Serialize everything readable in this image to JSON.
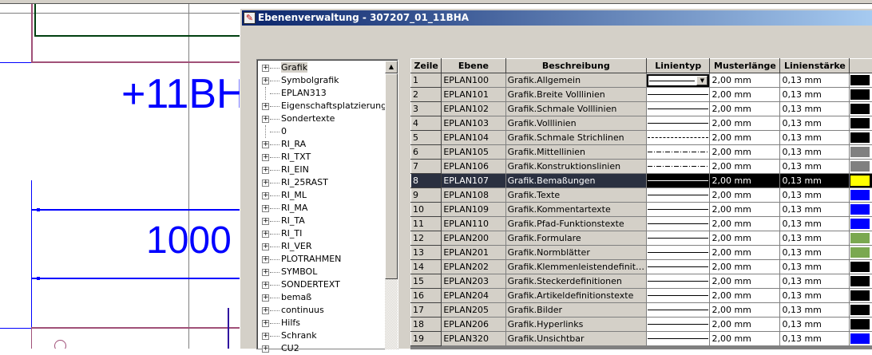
{
  "canvas": {
    "label_top": "+11BH",
    "dimension": "1000"
  },
  "dialog": {
    "title": "Ebenenverwaltung - 307207_01_11BHA"
  },
  "tree": {
    "items": [
      {
        "label": "Grafik",
        "expandable": true
      },
      {
        "label": "Symbolgrafik",
        "expandable": true
      },
      {
        "label": "EPLAN313",
        "expandable": false
      },
      {
        "label": "Eigenschaftsplatzierung",
        "expandable": true
      },
      {
        "label": "Sondertexte",
        "expandable": true
      },
      {
        "label": "0",
        "expandable": false
      },
      {
        "label": "RI_RA",
        "expandable": true
      },
      {
        "label": "RI_TXT",
        "expandable": true
      },
      {
        "label": "RI_EIN",
        "expandable": true
      },
      {
        "label": "RI_25RAST",
        "expandable": true
      },
      {
        "label": "RI_ML",
        "expandable": true
      },
      {
        "label": "RI_MA",
        "expandable": true
      },
      {
        "label": "RI_TA",
        "expandable": true
      },
      {
        "label": "RI_TI",
        "expandable": true
      },
      {
        "label": "RI_VER",
        "expandable": true
      },
      {
        "label": "PLOTRAHMEN",
        "expandable": true
      },
      {
        "label": "SYMBOL",
        "expandable": true
      },
      {
        "label": "SONDERTEXT",
        "expandable": true
      },
      {
        "label": "bemaß",
        "expandable": true
      },
      {
        "label": "continuus",
        "expandable": true
      },
      {
        "label": "Hilfs",
        "expandable": true
      },
      {
        "label": "Schrank",
        "expandable": true
      },
      {
        "label": "CU2",
        "expandable": true
      }
    ]
  },
  "table": {
    "headers": [
      "Zeile",
      "Ebene",
      "Beschreibung",
      "Linientyp",
      "Musterlänge",
      "Linienstärke",
      ""
    ],
    "rows": [
      {
        "zeile": "1",
        "ebene": "EPLAN100",
        "beschreibung": "Grafik.Allgemein",
        "linetype": "solid",
        "muster": "2,00 mm",
        "staerke": "0,13 mm",
        "color": "#000000"
      },
      {
        "zeile": "2",
        "ebene": "EPLAN101",
        "beschreibung": "Grafik.Breite Volllinien",
        "linetype": "solid",
        "muster": "2,00 mm",
        "staerke": "0,13 mm",
        "color": "#000000"
      },
      {
        "zeile": "3",
        "ebene": "EPLAN102",
        "beschreibung": "Grafik.Schmale Volllinien",
        "linetype": "solid",
        "muster": "2,00 mm",
        "staerke": "0,13 mm",
        "color": "#000000"
      },
      {
        "zeile": "4",
        "ebene": "EPLAN103",
        "beschreibung": "Grafik.Volllinien",
        "linetype": "solid",
        "muster": "2,00 mm",
        "staerke": "0,13 mm",
        "color": "#000000"
      },
      {
        "zeile": "5",
        "ebene": "EPLAN104",
        "beschreibung": "Grafik.Schmale Strichlinen",
        "linetype": "dashed",
        "muster": "2,00 mm",
        "staerke": "0,13 mm",
        "color": "#000000"
      },
      {
        "zeile": "6",
        "ebene": "EPLAN105",
        "beschreibung": "Grafik.Mittellinien",
        "linetype": "dashdot",
        "muster": "2,00 mm",
        "staerke": "0,13 mm",
        "color": "#808080"
      },
      {
        "zeile": "7",
        "ebene": "EPLAN106",
        "beschreibung": "Grafik.Konstruktionslinien",
        "linetype": "dashdot",
        "muster": "2,00 mm",
        "staerke": "0,13 mm",
        "color": "#808080"
      },
      {
        "zeile": "8",
        "ebene": "EPLAN107",
        "beschreibung": "Grafik.Bemaßungen",
        "linetype": "solid",
        "muster": "2,00 mm",
        "staerke": "0,13 mm",
        "color": "#ffff00",
        "selected": true
      },
      {
        "zeile": "9",
        "ebene": "EPLAN108",
        "beschreibung": "Grafik.Texte",
        "linetype": "solid",
        "muster": "2,00 mm",
        "staerke": "0,13 mm",
        "color": "#0000ff"
      },
      {
        "zeile": "10",
        "ebene": "EPLAN109",
        "beschreibung": "Grafik.Kommentartexte",
        "linetype": "solid",
        "muster": "2,00 mm",
        "staerke": "0,13 mm",
        "color": "#0000ff"
      },
      {
        "zeile": "11",
        "ebene": "EPLAN110",
        "beschreibung": "Grafik.Pfad-Funktionstexte",
        "linetype": "solid",
        "muster": "2,00 mm",
        "staerke": "0,13 mm",
        "color": "#0000ff"
      },
      {
        "zeile": "12",
        "ebene": "EPLAN200",
        "beschreibung": "Grafik.Formulare",
        "linetype": "solid",
        "muster": "2,00 mm",
        "staerke": "0,13 mm",
        "color": "#7aa850"
      },
      {
        "zeile": "13",
        "ebene": "EPLAN201",
        "beschreibung": "Grafik.Normblätter",
        "linetype": "solid",
        "muster": "2,00 mm",
        "staerke": "0,13 mm",
        "color": "#7aa850"
      },
      {
        "zeile": "14",
        "ebene": "EPLAN202",
        "beschreibung": "Grafik.Klemmenleistendefinit…",
        "linetype": "solid",
        "muster": "2,00 mm",
        "staerke": "0,13 mm",
        "color": "#000000"
      },
      {
        "zeile": "15",
        "ebene": "EPLAN203",
        "beschreibung": "Grafik.Steckerdefinitionen",
        "linetype": "solid",
        "muster": "2,00 mm",
        "staerke": "0,13 mm",
        "color": "#000000"
      },
      {
        "zeile": "16",
        "ebene": "EPLAN204",
        "beschreibung": "Grafik.Artikeldefinitionstexte",
        "linetype": "solid",
        "muster": "2,00 mm",
        "staerke": "0,13 mm",
        "color": "#000000"
      },
      {
        "zeile": "17",
        "ebene": "EPLAN205",
        "beschreibung": "Grafik.Bilder",
        "linetype": "solid",
        "muster": "2,00 mm",
        "staerke": "0,13 mm",
        "color": "#000000"
      },
      {
        "zeile": "18",
        "ebene": "EPLAN206",
        "beschreibung": "Grafik.Hyperlinks",
        "linetype": "solid",
        "muster": "2,00 mm",
        "staerke": "0,13 mm",
        "color": "#000000"
      },
      {
        "zeile": "19",
        "ebene": "EPLAN320",
        "beschreibung": "Grafik.Unsichtbar",
        "linetype": "solid",
        "muster": "2,00 mm",
        "staerke": "0,13 mm",
        "color": "#0000ff"
      }
    ]
  }
}
